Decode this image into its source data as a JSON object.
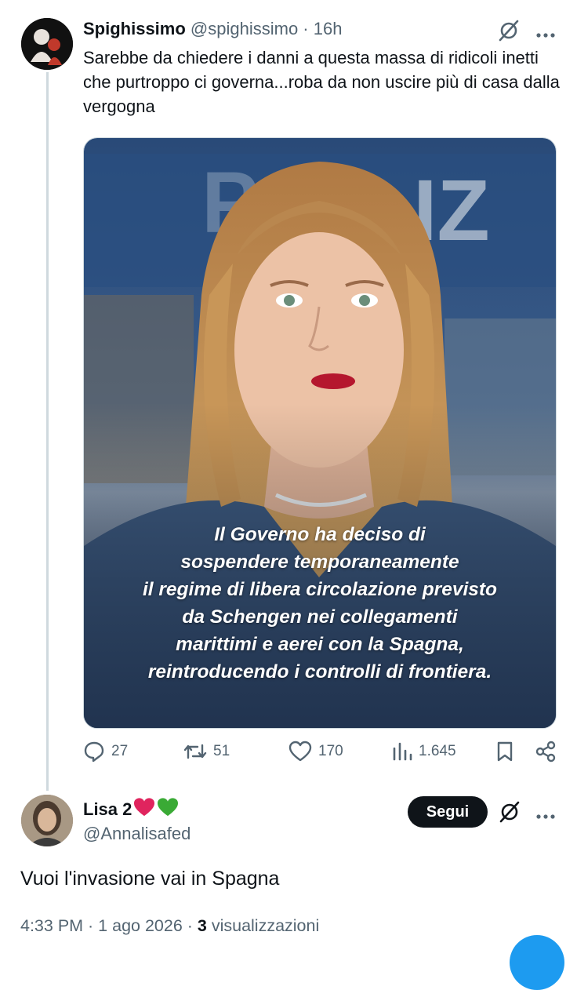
{
  "post": {
    "display_name": "Spighissimo",
    "handle": "@spighissimo",
    "separator": " · ",
    "time": "16h",
    "text": "Sarebbe da chiedere i danni a questa massa di ridicoli inetti che purtroppo ci governa...roba da non uscire più di casa dalla vergogna",
    "image_overlay_lines": [
      "Il Governo ha deciso di",
      "sospendere temporaneamente",
      "il regime di libera circolazione previsto",
      "da Schengen nei collegamenti",
      "marittimi e aerei con la Spagna,",
      "reintroducendo i controlli di frontiera."
    ],
    "stats": {
      "replies": "27",
      "reposts": "51",
      "likes": "170",
      "views": "1.645"
    }
  },
  "reply": {
    "display_name": "Lisa 2",
    "hearts": [
      "red-heart",
      "green-heart"
    ],
    "handle": "@Annalisafed",
    "follow_label": "Segui",
    "text": "Vuoi l'invasione vai in Spagna",
    "timestamp": "4:33 PM · 1 ago 2026 · ",
    "views_count": "3",
    "views_label": " visualizzazioni"
  },
  "colors": {
    "text_primary": "#0f1419",
    "text_secondary": "#536471",
    "thread_line": "#cfd9de",
    "accent": "#1d9bf0",
    "heart_red": "#e0245e",
    "heart_green": "#3aaa35"
  }
}
